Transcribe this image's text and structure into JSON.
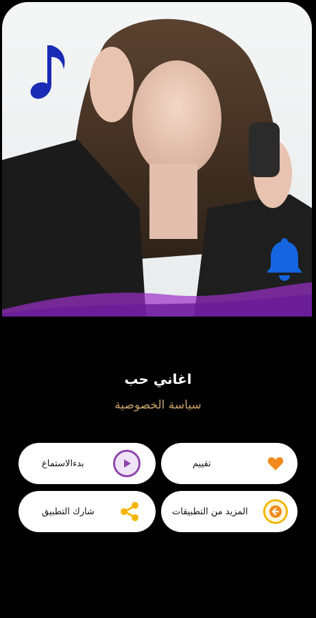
{
  "app": {
    "title": "اغاني حب",
    "privacy_link": "سياسة الخصوصية"
  },
  "buttons": {
    "listen": "بدءالاستماع",
    "rate": "تقييم",
    "share": "شارك التطبيق",
    "more_apps": "المزيد من التطبيقات"
  },
  "colors": {
    "background": "#000000",
    "accent_gold": "#c9a26a",
    "music_icon": "#1a2bb5",
    "bell_icon": "#1565e0",
    "play_circle": "#8e44ad",
    "heart": "#f08a1c",
    "share": "#f2b600",
    "wave_purple": "#9b2fc9"
  },
  "icons": {
    "hero_left": "music-note-icon",
    "hero_right": "bell-icon",
    "listen": "play-icon",
    "rate": "heart-icon",
    "share": "share-icon",
    "more_apps": "arrow-left-circle-icon"
  }
}
